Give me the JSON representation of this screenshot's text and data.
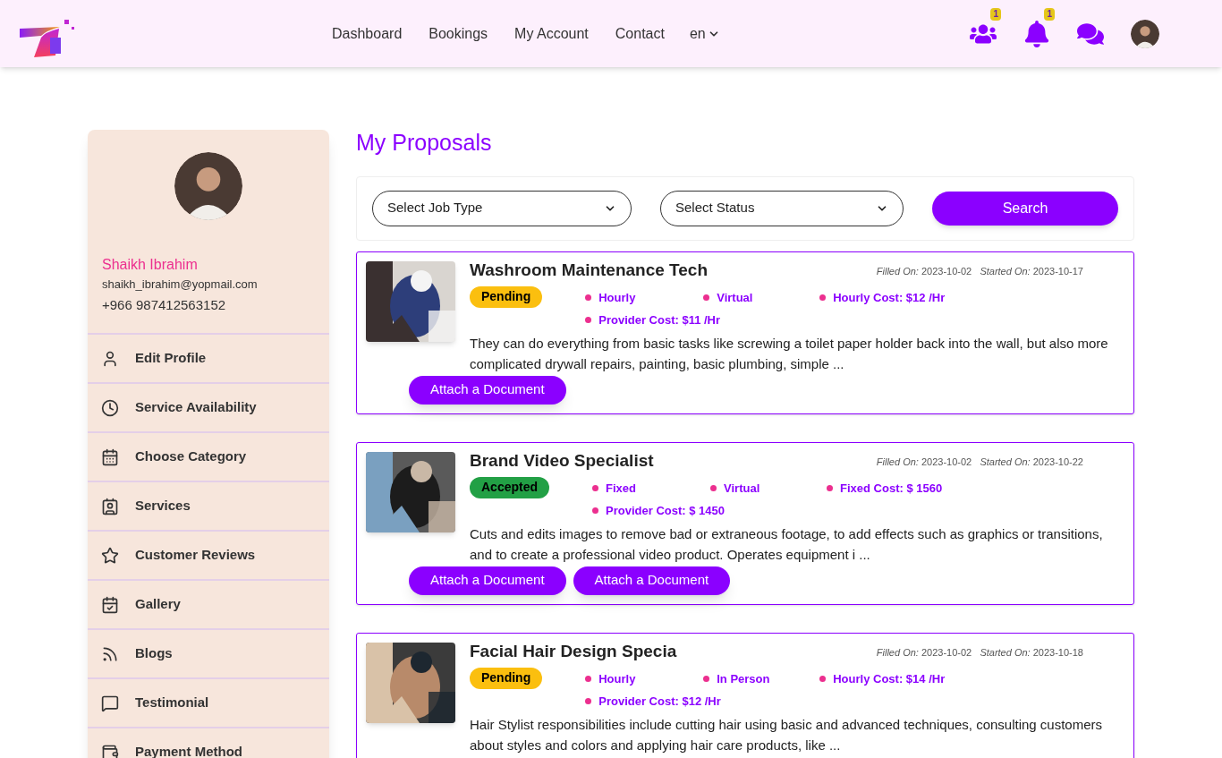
{
  "nav": {
    "links": [
      "Dashboard",
      "Bookings",
      "My Account",
      "Contact"
    ],
    "language": "en",
    "notification_counts": [
      "1",
      "1"
    ]
  },
  "profile": {
    "name": "Shaikh Ibrahim",
    "email": "shaikh_ibrahim@yopmail.com",
    "phone": "+966 987412563152"
  },
  "sidebar": {
    "items": [
      {
        "label": "Edit Profile"
      },
      {
        "label": "Service Availability"
      },
      {
        "label": "Choose Category"
      },
      {
        "label": "Services"
      },
      {
        "label": "Customer Reviews"
      },
      {
        "label": "Gallery"
      },
      {
        "label": "Blogs"
      },
      {
        "label": "Testimonial"
      },
      {
        "label": "Payment Method"
      }
    ]
  },
  "page_title": "My Proposals",
  "filters": {
    "job_type": "Select Job Type",
    "status": "Select Status",
    "search_button": "Search"
  },
  "proposals": [
    {
      "title": "Washroom Maintenance Tech",
      "filled_label": "Filled On:",
      "filled": "2023-10-02",
      "started_label": "Started On:",
      "started": "2023-10-17",
      "status": {
        "text": "Pending",
        "kind": "pending"
      },
      "meta": [
        "Hourly",
        "Virtual",
        "Hourly Cost: $12 /Hr",
        "Provider Cost: $11 /Hr"
      ],
      "description": "They can do everything from basic tasks like screwing a toilet paper holder back into the wall, but also more complicated drywall repairs, painting, basic plumbing, simple ...",
      "buttons": [
        "Attach a Document"
      ]
    },
    {
      "title": "Brand Video Specialist",
      "filled_label": "Filled On:",
      "filled": "2023-10-02",
      "started_label": "Started On:",
      "started": "2023-10-22",
      "status": {
        "text": "Accepted",
        "kind": "accepted"
      },
      "meta": [
        "Fixed",
        "Virtual",
        "Fixed Cost: $ 1560",
        "Provider Cost: $ 1450"
      ],
      "description": "Cuts and edits images to remove bad or extraneous footage, to add effects such as graphics or transitions, and to create a professional video product. Operates equipment i ...",
      "buttons": [
        "Attach a Document",
        "Attach a Document"
      ]
    },
    {
      "title": "Facial Hair Design Specia",
      "filled_label": "Filled On:",
      "filled": "2023-10-02",
      "started_label": "Started On:",
      "started": "2023-10-18",
      "status": {
        "text": "Pending",
        "kind": "pending"
      },
      "meta": [
        "Hourly",
        "In Person",
        "Hourly Cost: $14 /Hr",
        "Provider Cost: $12 /Hr"
      ],
      "description": "Hair Stylist responsibilities include cutting hair using basic and advanced techniques, consulting customers about styles and colors and applying hair care products, like ..."
    }
  ]
}
